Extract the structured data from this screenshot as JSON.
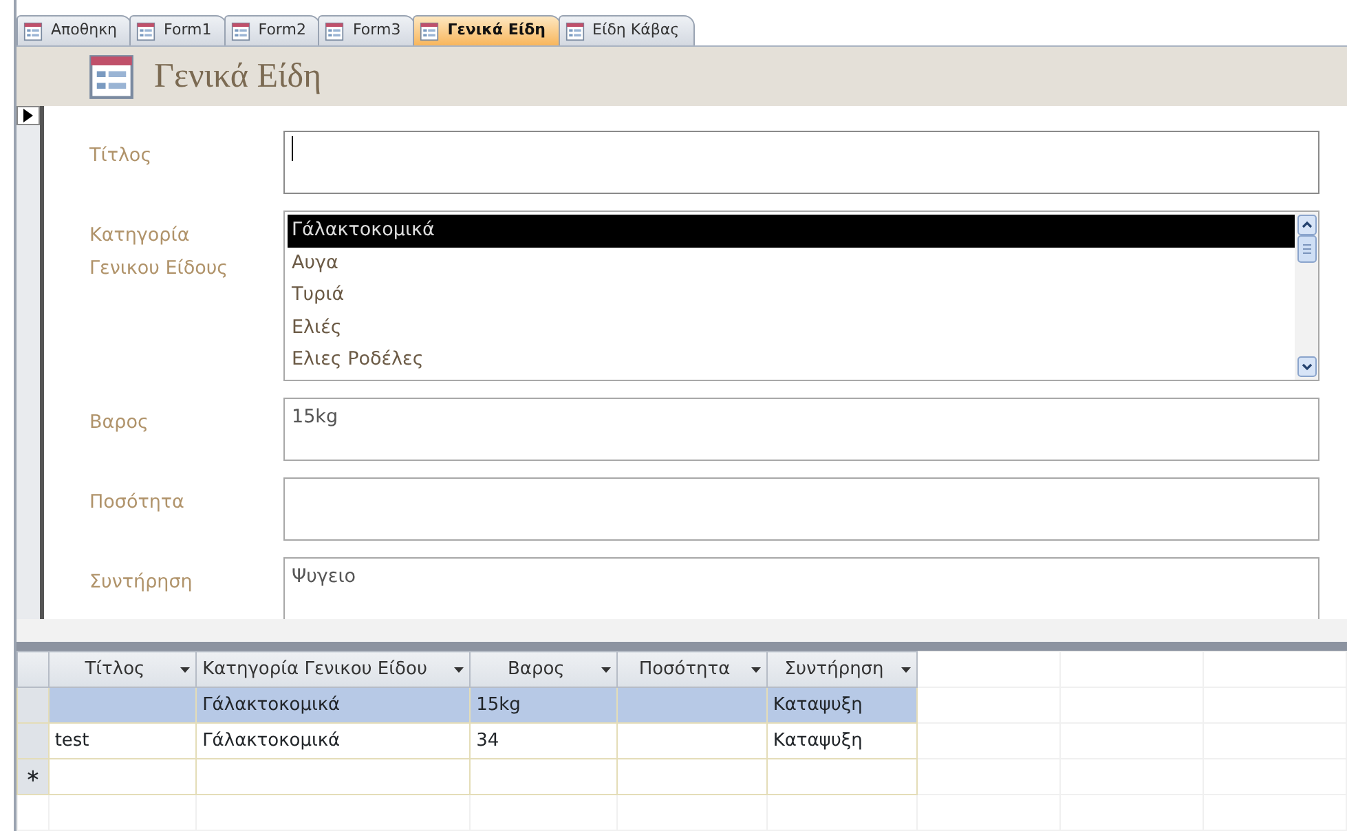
{
  "tabs": [
    {
      "label": "Αποθηκη",
      "selected": false
    },
    {
      "label": "Form1",
      "selected": false
    },
    {
      "label": "Form2",
      "selected": false
    },
    {
      "label": "Form3",
      "selected": false
    },
    {
      "label": "Γενικά Είδη",
      "selected": true
    },
    {
      "label": "Είδη Κάβας",
      "selected": false
    }
  ],
  "form": {
    "title": "Γενικά Είδη",
    "fields": [
      {
        "kind": "text",
        "label": "Τίτλος",
        "focused": true
      },
      {
        "kind": "list",
        "label": "Κατηγορία Γενικου Είδους",
        "items": [
          {
            "text": "Γάλακτοκομικά",
            "selected": true
          },
          {
            "text": "Αυγα",
            "selected": false
          },
          {
            "text": "Τυριά",
            "selected": false
          },
          {
            "text": "Ελιές",
            "selected": false
          },
          {
            "text": "Ελιες Ροδέλες",
            "selected": false
          }
        ]
      },
      {
        "kind": "text",
        "label": "Βαρος",
        "value": "15kg",
        "focused": false
      },
      {
        "kind": "text",
        "label": "Ποσότητα",
        "focused": false
      },
      {
        "kind": "text",
        "label": "Συντήρηση",
        "value": "Ψυγειο",
        "focused": false
      }
    ]
  },
  "datasheet": {
    "columns": [
      "Τίτλος",
      "Κατηγορία Γενικου Είδου",
      "Βαρος",
      "Ποσότητα",
      "Συντήρηση"
    ],
    "rows": [
      {
        "cells": [
          "",
          "Γάλακτοκομικά",
          "15kg",
          "",
          "Καταψυξη"
        ],
        "selected": true
      },
      {
        "cells": [
          "test",
          "Γάλακτοκομικά",
          "34",
          "",
          "Καταψυξη"
        ],
        "selected": false
      }
    ],
    "new_row_marker": "∗"
  }
}
